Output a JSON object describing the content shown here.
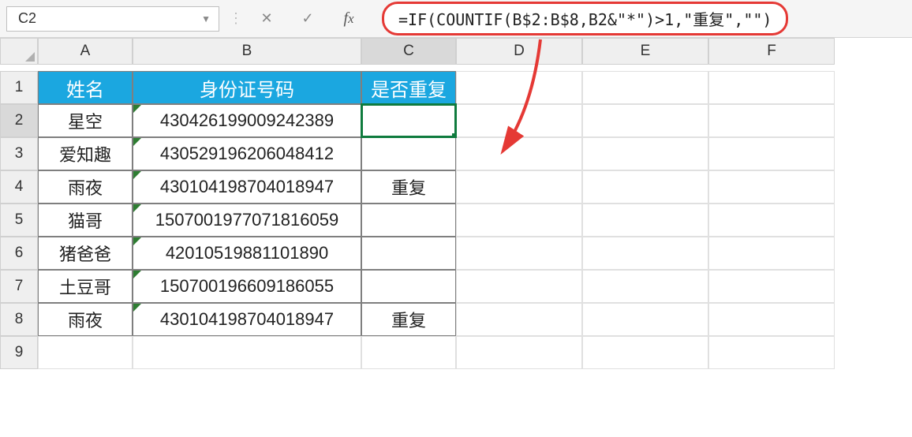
{
  "formula_bar": {
    "cell_ref": "C2",
    "formula": "=IF(COUNTIF(B$2:B$8,B2&\"*\")>1,\"重复\",\"\")"
  },
  "columns": [
    "A",
    "B",
    "C",
    "D",
    "E",
    "F"
  ],
  "rows": [
    "1",
    "2",
    "3",
    "4",
    "5",
    "6",
    "7",
    "8",
    "9"
  ],
  "selected_row": "2",
  "selected_col": "C",
  "headers": {
    "A": "姓名",
    "B": "身份证号码",
    "C": "是否重复"
  },
  "data": [
    {
      "A": "星空",
      "B": "430426199009242389",
      "C": ""
    },
    {
      "A": "爱知趣",
      "B": "430529196206048412",
      "C": ""
    },
    {
      "A": "雨夜",
      "B": "430104198704018947",
      "C": "重复"
    },
    {
      "A": "猫哥",
      "B": "150700197707181605",
      "B_suffix": "059",
      "C": ""
    },
    {
      "A": "猪爸爸",
      "B": "42010519881101890",
      "C": ""
    },
    {
      "A": "土豆哥",
      "B": "150700196609186055",
      "C": ""
    },
    {
      "A": "雨夜",
      "B": "430104198704018947",
      "C": "重复"
    }
  ],
  "annotation": {
    "arrow_color": "#e53935"
  }
}
